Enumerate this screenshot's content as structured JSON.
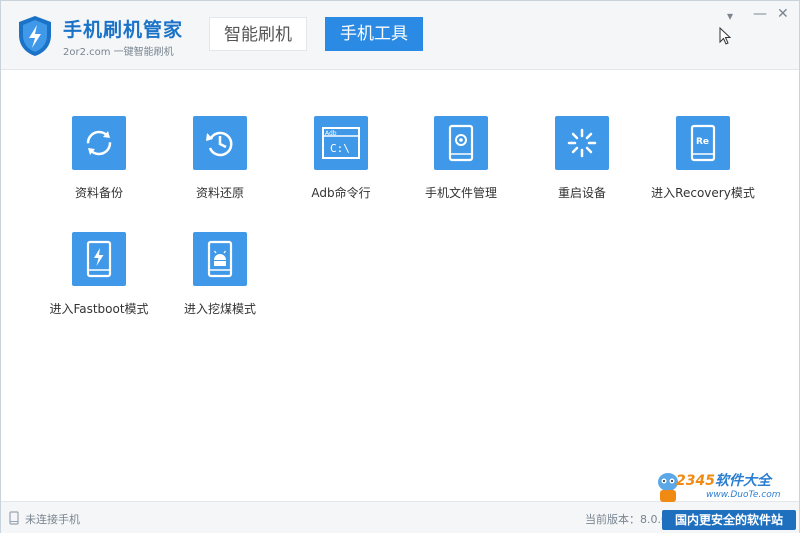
{
  "app": {
    "title": "手机刷机管家",
    "subtitle": "2or2.com 一键智能刷机"
  },
  "tabs": [
    {
      "label": "智能刷机"
    },
    {
      "label": "手机工具"
    }
  ],
  "window_controls": {
    "dropdown": "▾",
    "minimize": "—",
    "close": "✕"
  },
  "tools": [
    {
      "label": "资料备份",
      "icon": "backup-icon"
    },
    {
      "label": "资料还原",
      "icon": "restore-icon"
    },
    {
      "label": "Adb命令行",
      "icon": "terminal-icon",
      "icon_text": "Adb",
      "icon_prompt": "C:\\"
    },
    {
      "label": "手机文件管理",
      "icon": "phone-file-icon"
    },
    {
      "label": "重启设备",
      "icon": "reboot-icon"
    },
    {
      "label": "进入Recovery模式",
      "icon": "recovery-icon",
      "icon_text": "Re"
    },
    {
      "label": "进入Fastboot模式",
      "icon": "fastboot-icon"
    },
    {
      "label": "进入挖煤模式",
      "icon": "download-mode-icon"
    }
  ],
  "status": {
    "connection": "未连接手机",
    "version": "当前版本：8.0.0"
  },
  "watermark": {
    "brand_number": "2345",
    "brand_text": "软件大全",
    "url": "www.DuoTe.com",
    "slogan": "国内更安全的软件站"
  },
  "colors": {
    "accent": "#2b8ae3",
    "tile": "#3f98e8",
    "brand": "#1b73c8"
  }
}
